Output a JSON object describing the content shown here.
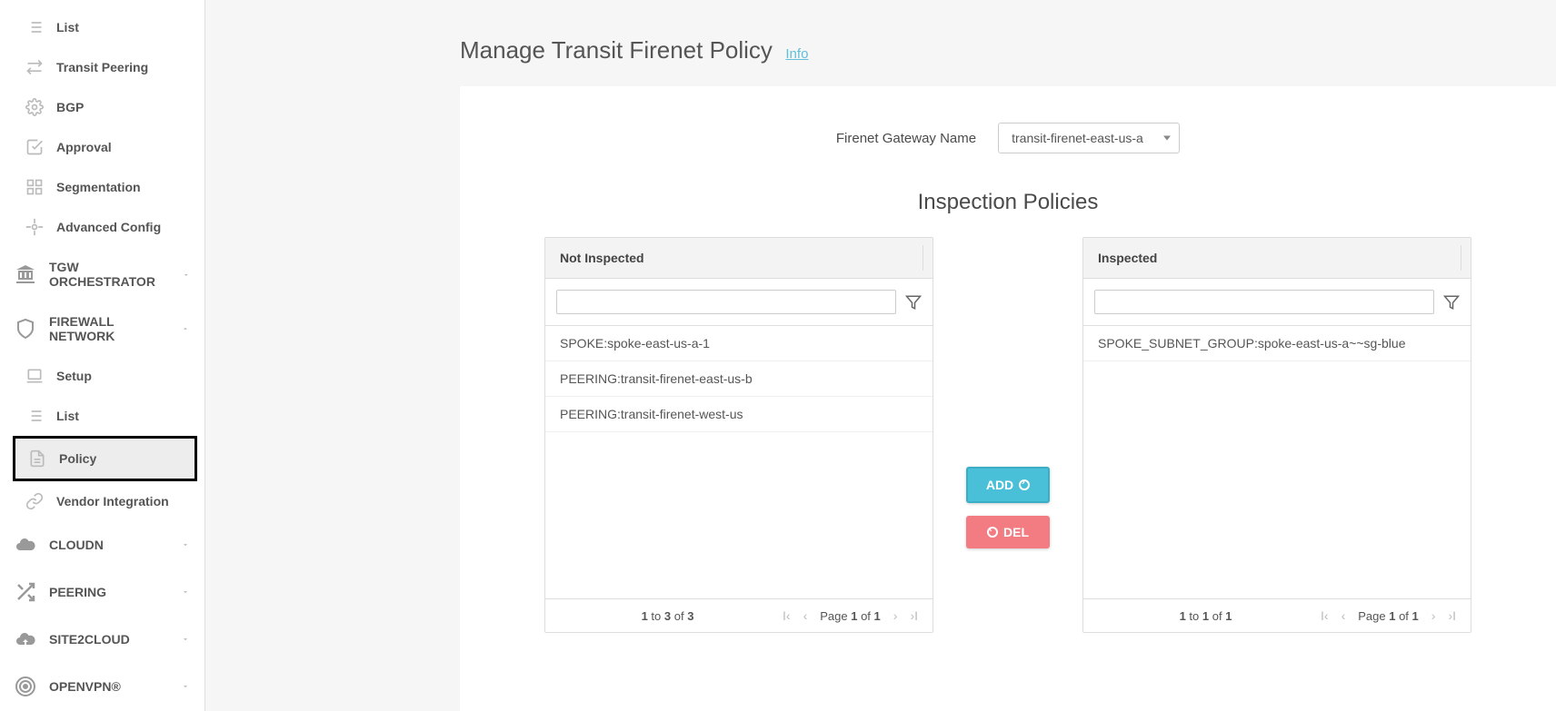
{
  "sidebar": {
    "nav_sub": [
      {
        "label": "List",
        "icon": "list"
      },
      {
        "label": "Transit Peering",
        "icon": "swap"
      },
      {
        "label": "BGP",
        "icon": "gear"
      },
      {
        "label": "Approval",
        "icon": "check-square"
      },
      {
        "label": "Segmentation",
        "icon": "segment"
      },
      {
        "label": "Advanced Config",
        "icon": "cog"
      }
    ],
    "tgw": {
      "label": "TGW ORCHESTRATOR"
    },
    "firewall": {
      "label": "FIREWALL NETWORK",
      "children": [
        {
          "label": "Setup",
          "icon": "laptop"
        },
        {
          "label": "List",
          "icon": "list"
        },
        {
          "label": "Policy",
          "icon": "file",
          "active": true
        },
        {
          "label": "Vendor Integration",
          "icon": "link"
        }
      ]
    },
    "cloudn": {
      "label": "CLOUDN"
    },
    "peering": {
      "label": "PEERING"
    },
    "site2cloud": {
      "label": "SITE2CLOUD"
    },
    "openvpn": {
      "label": "OPENVPN®"
    }
  },
  "page": {
    "title": "Manage Transit Firenet Policy",
    "info": "Info"
  },
  "gateway": {
    "label": "Firenet Gateway Name",
    "selected": "transit-firenet-east-us-a"
  },
  "inspection": {
    "title": "Inspection Policies",
    "not_inspected": {
      "header": "Not Inspected",
      "items": [
        "SPOKE:spoke-east-us-a-1",
        "PEERING:transit-firenet-east-us-b",
        "PEERING:transit-firenet-west-us"
      ],
      "summary_prefix": "1",
      "summary_mid1": " to ",
      "summary_total1": "3",
      "summary_of": " of ",
      "summary_total2": "3",
      "page_label_prefix": "Page ",
      "page_current": "1",
      "page_of_label": " of ",
      "page_total": "1"
    },
    "inspected": {
      "header": "Inspected",
      "items": [
        "SPOKE_SUBNET_GROUP:spoke-east-us-a~~sg-blue"
      ],
      "summary_prefix": "1",
      "summary_mid1": " to ",
      "summary_total1": "1",
      "summary_of": " of ",
      "summary_total2": "1",
      "page_label_prefix": "Page ",
      "page_current": "1",
      "page_of_label": " of ",
      "page_total": "1"
    },
    "btn_add": "ADD",
    "btn_del": "DEL"
  }
}
